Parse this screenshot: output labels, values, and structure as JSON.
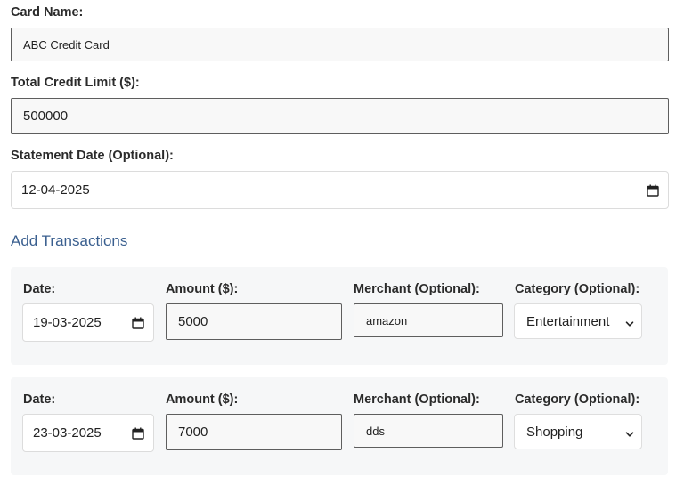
{
  "card": {
    "name_label": "Card Name:",
    "name_value": "ABC Credit Card",
    "limit_label": "Total Credit Limit ($):",
    "limit_value": "500000",
    "statement_label": "Statement Date (Optional):",
    "statement_value": "12-04-2025"
  },
  "transactions_title": "Add Transactions",
  "transactions": [
    {
      "date_label": "Date:",
      "date_value": "19-03-2025",
      "amount_label": "Amount ($):",
      "amount_value": "5000",
      "merchant_label": "Merchant (Optional):",
      "merchant_value": "amazon",
      "category_label": "Category (Optional):",
      "category_value": "Entertainment"
    },
    {
      "date_label": "Date:",
      "date_value": "23-03-2025",
      "amount_label": "Amount ($):",
      "amount_value": "7000",
      "merchant_label": "Merchant (Optional):",
      "merchant_value": "dds",
      "category_label": "Category (Optional):",
      "category_value": "Shopping"
    }
  ],
  "icons": {
    "calendar": "calendar-icon",
    "dropdown": "chevron-down-icon"
  },
  "colors": {
    "section_title": "#3a5f8f",
    "transaction_background": "#f6f7f8"
  }
}
